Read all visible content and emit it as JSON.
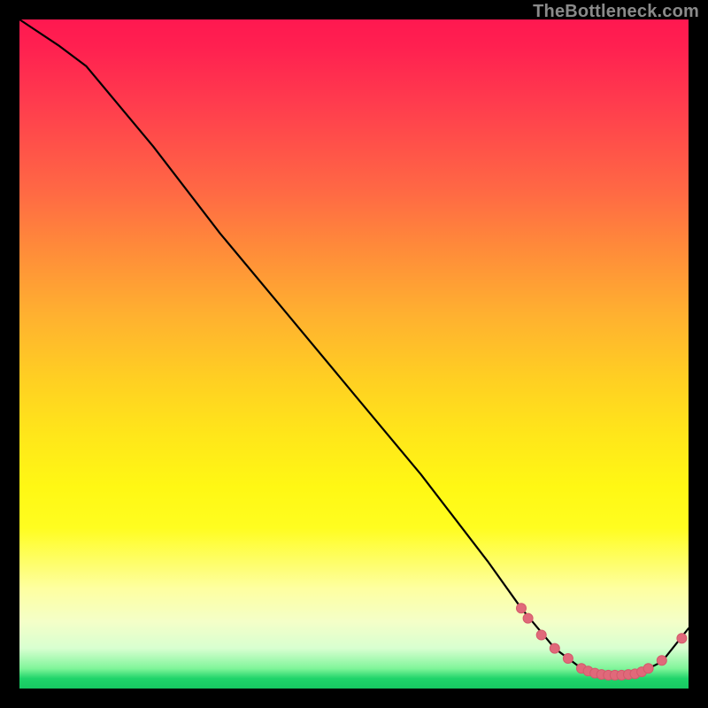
{
  "watermark": "TheBottleneck.com",
  "colors": {
    "curve_stroke": "#000000",
    "marker_fill": "#e0697a",
    "marker_stroke": "#d35a6c",
    "background": "#000000"
  },
  "chart_data": {
    "type": "line",
    "title": "",
    "xlabel": "",
    "ylabel": "",
    "xlim": [
      0,
      100
    ],
    "ylim": [
      0,
      100
    ],
    "grid": false,
    "legend": false,
    "series": [
      {
        "name": "curve",
        "x": [
          0,
          6,
          10,
          20,
          30,
          40,
          50,
          60,
          70,
          75,
          80,
          84,
          88,
          92,
          96,
          100
        ],
        "values": [
          100,
          96,
          93,
          81,
          68,
          56,
          44,
          32,
          19,
          12,
          6,
          3,
          2,
          2,
          4,
          9
        ]
      }
    ],
    "markers": {
      "name": "highlight-points",
      "x": [
        75,
        76,
        78,
        80,
        82,
        84,
        85,
        86,
        87,
        88,
        89,
        90,
        91,
        92,
        93,
        94,
        96,
        99
      ],
      "values": [
        12,
        10.5,
        8,
        6,
        4.5,
        3,
        2.6,
        2.3,
        2.1,
        2,
        2,
        2,
        2.1,
        2.2,
        2.5,
        3,
        4.2,
        7.5
      ]
    }
  }
}
